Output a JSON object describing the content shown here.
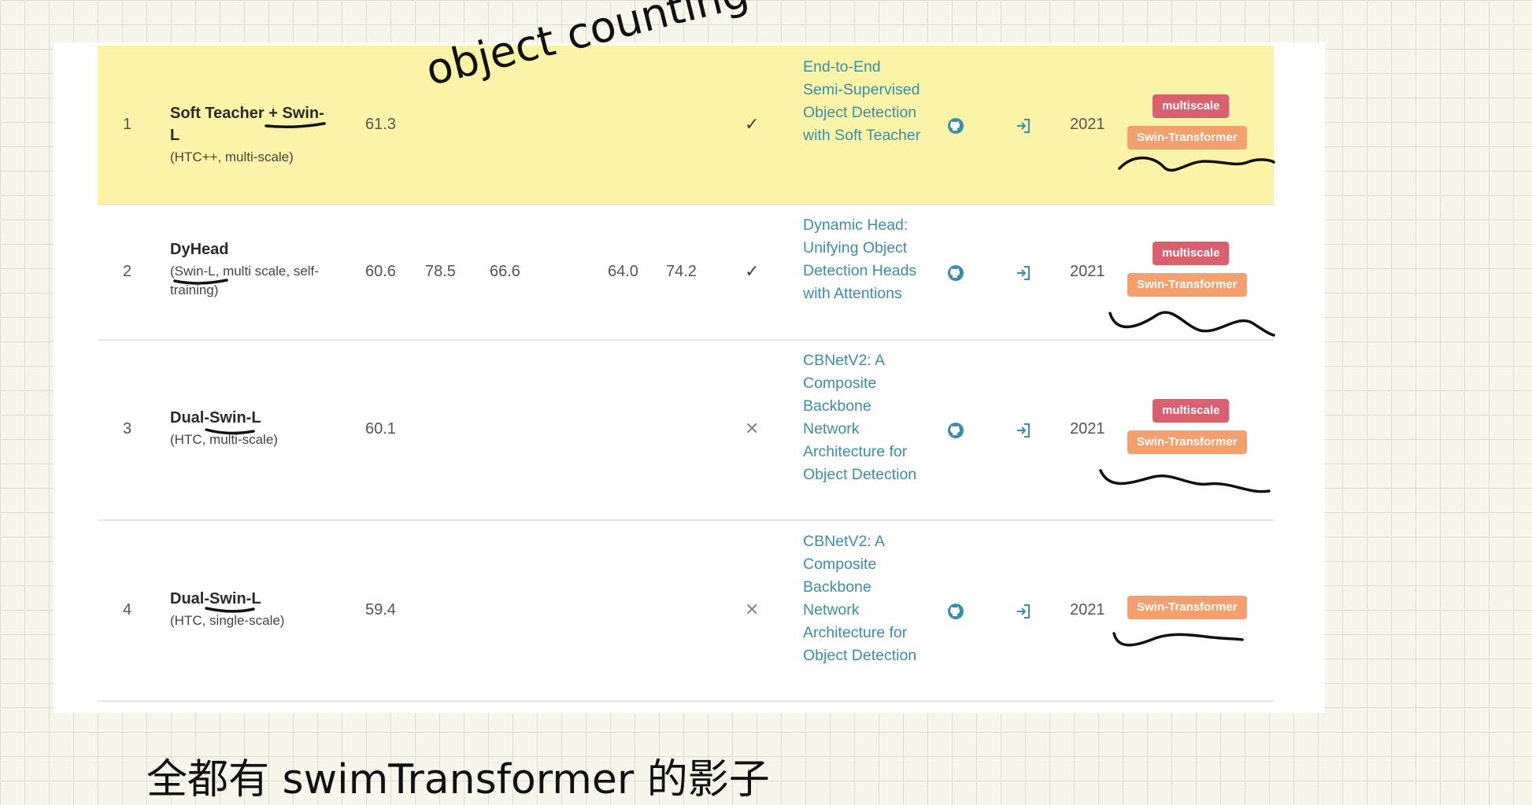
{
  "rows": [
    {
      "rank": "1",
      "name": "Soft Teacher + Swin-L",
      "detail": "(HTC++, multi-scale)",
      "box_ap": "61.3",
      "ap50": "",
      "ap75": "",
      "aps": "",
      "apm": "",
      "extra": "✓",
      "paper": "End-to-End Semi-Supervised Object Detection with Soft Teacher",
      "year": "2021",
      "tags": [
        "multiscale",
        "Swin-Transformer"
      ]
    },
    {
      "rank": "2",
      "name": "DyHead",
      "detail": "(Swin-L, multi scale, self-training)",
      "box_ap": "60.6",
      "ap50": "78.5",
      "ap75": "66.6",
      "aps": "64.0",
      "apm": "74.2",
      "extra": "✓",
      "paper": "Dynamic Head: Unifying Object Detection Heads with Attentions",
      "year": "2021",
      "tags": [
        "multiscale",
        "Swin-Transformer"
      ]
    },
    {
      "rank": "3",
      "name": "Dual-Swin-L",
      "detail": "(HTC, multi-scale)",
      "box_ap": "60.1",
      "ap50": "",
      "ap75": "",
      "aps": "",
      "apm": "",
      "extra": "✕",
      "paper": "CBNetV2: A Composite Backbone Network Architecture for Object Detection",
      "year": "2021",
      "tags": [
        "multiscale",
        "Swin-Transformer"
      ]
    },
    {
      "rank": "4",
      "name": "Dual-Swin-L",
      "detail": "(HTC, single-scale)",
      "box_ap": "59.4",
      "ap50": "",
      "ap75": "",
      "aps": "",
      "apm": "",
      "extra": "✕",
      "paper": "CBNetV2: A Composite Backbone Network Architecture for Object Detection",
      "year": "2021",
      "tags": [
        "Swin-Transformer"
      ]
    }
  ],
  "annotations": {
    "top_note": "object counting",
    "bottom_note": "全都有 swimTransformer 的影子"
  },
  "icons": {
    "code": "github-icon",
    "paper_link": "sign-in-icon"
  },
  "colors": {
    "highlight": "#fbf3a8",
    "link": "#3a8fa8",
    "tag_multiscale": "#d9616f",
    "tag_swin": "#f4a06e"
  }
}
